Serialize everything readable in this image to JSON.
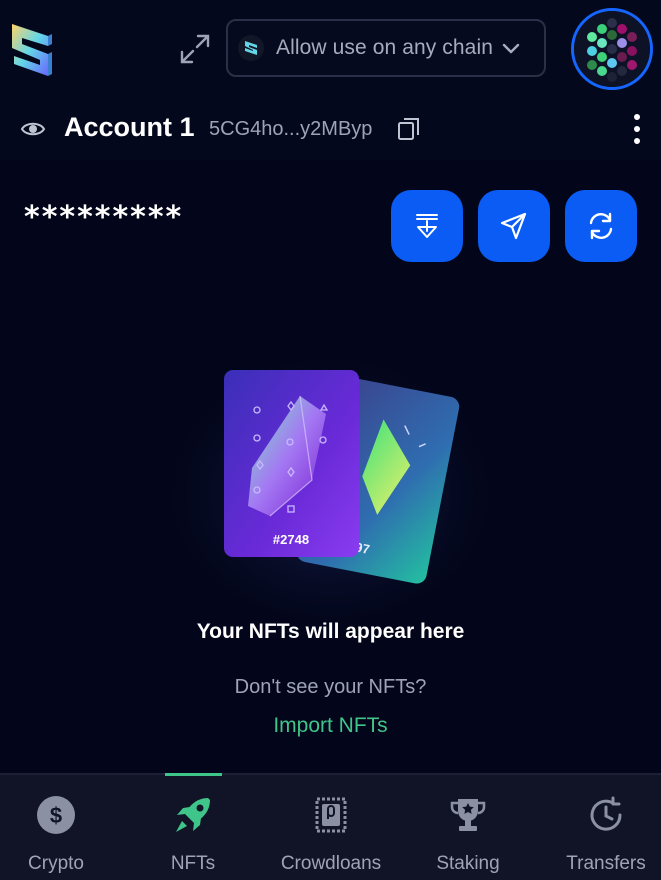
{
  "header": {
    "chain_selector": {
      "label": "Allow use on any chain"
    },
    "icons": {
      "logo": "subwallet-logo",
      "expand": "expand-icon",
      "avatar": "account-identicon"
    }
  },
  "account": {
    "name": "Account 1",
    "address_short": "5CG4ho...y2MByp"
  },
  "balance": {
    "masked": "*********"
  },
  "actions": [
    "receive-icon",
    "send-icon",
    "swap-icon"
  ],
  "empty_state": {
    "card_front_number": "#2748",
    "card_back_number": "#2797",
    "title": "Your NFTs will appear here",
    "subtitle": "Don't see your NFTs?",
    "import_link": "Import NFTs"
  },
  "tabs": [
    {
      "label": "Crypto",
      "icon": "dollar-icon"
    },
    {
      "label": "NFTs",
      "icon": "rocket-icon",
      "active": true
    },
    {
      "label": "Crowdloans",
      "icon": "crowdloan-icon"
    },
    {
      "label": "Staking",
      "icon": "trophy-icon"
    },
    {
      "label": "Transfers",
      "icon": "history-icon"
    }
  ],
  "colors": {
    "background": "#03061a",
    "accent_blue": "#0a5cf5",
    "accent_green": "#3fc48a",
    "muted_text": "#9ea3b5",
    "tabbar": "#101426"
  }
}
